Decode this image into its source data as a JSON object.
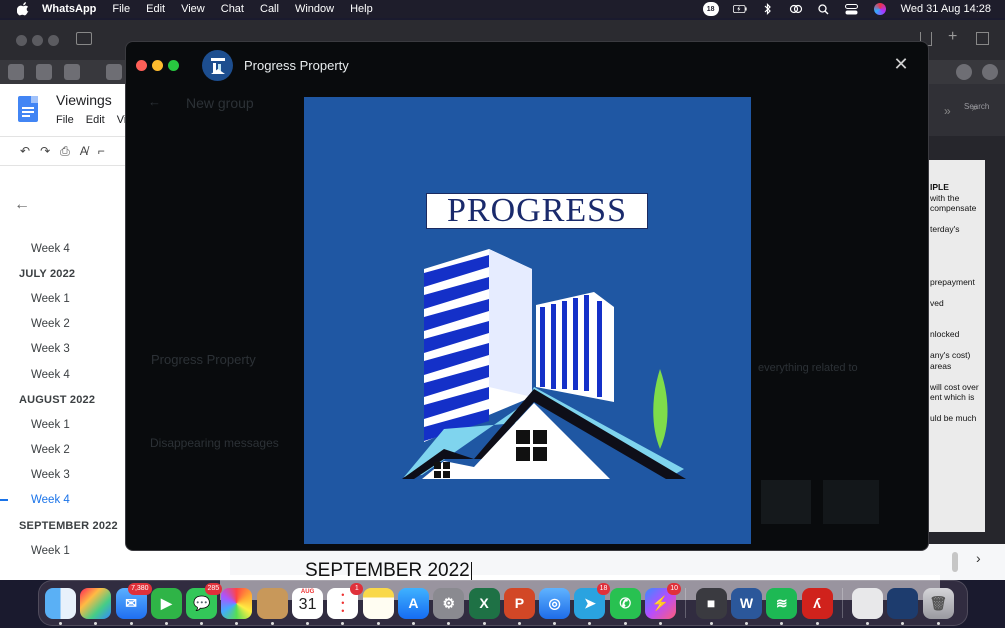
{
  "menubar": {
    "app_name": "WhatsApp",
    "items": [
      "File",
      "Edit",
      "View",
      "Chat",
      "Call",
      "Window",
      "Help"
    ],
    "status_badge": "18",
    "clock": "Wed 31 Aug  14:28"
  },
  "docs": {
    "title": "Viewings",
    "menu": [
      "File",
      "Edit",
      "Vi"
    ],
    "outline": [
      {
        "label": "Week 4",
        "kind": "week"
      },
      {
        "label": "JULY 2022",
        "kind": "heading"
      },
      {
        "label": "Week 1",
        "kind": "week"
      },
      {
        "label": "Week 2",
        "kind": "week"
      },
      {
        "label": "Week 3",
        "kind": "week"
      },
      {
        "label": "Week 4",
        "kind": "week"
      },
      {
        "label": "AUGUST 2022",
        "kind": "heading"
      },
      {
        "label": "Week 1",
        "kind": "week"
      },
      {
        "label": "Week 2",
        "kind": "week"
      },
      {
        "label": "Week 3",
        "kind": "week"
      },
      {
        "label": "Week 4",
        "kind": "week",
        "active": true
      },
      {
        "label": "SEPTEMBER 2022",
        "kind": "heading"
      },
      {
        "label": "Week 1",
        "kind": "week"
      }
    ],
    "body_text": "SEPTEMBER 2022"
  },
  "whatsapp_backdrop": {
    "header": "New group",
    "name_field": "Progress Property",
    "disappearing": "Disappearing messages",
    "description_snippet": "everything related to"
  },
  "right_doc": {
    "search_label": "Search",
    "lines": [
      "IPLE",
      "with the",
      "compensate",
      "",
      "terday's",
      "",
      "",
      "",
      "",
      "prepayment",
      "",
      "ved",
      "",
      "",
      "nlocked",
      "",
      "any's cost)",
      "areas",
      "",
      "will cost over",
      "ent which is",
      "",
      "uld be much"
    ]
  },
  "media_viewer": {
    "title": "Progress Property",
    "logo_text": "PROGRESS",
    "colors": {
      "background": "#1f57a3",
      "building_blue": "#1430c8",
      "roof": "#7fd4ee",
      "tree": "#7fdc4a"
    }
  },
  "dock": {
    "apps": [
      {
        "name": "finder",
        "badge": ""
      },
      {
        "name": "launchpad",
        "badge": ""
      },
      {
        "name": "mail",
        "badge": "7,380"
      },
      {
        "name": "facetime",
        "badge": ""
      },
      {
        "name": "messages",
        "badge": "285"
      },
      {
        "name": "photos",
        "badge": ""
      },
      {
        "name": "contacts",
        "badge": ""
      },
      {
        "name": "calendar",
        "badge": "",
        "month": "AUG",
        "day": "31"
      },
      {
        "name": "reminders",
        "badge": "1"
      },
      {
        "name": "notes",
        "badge": ""
      },
      {
        "name": "app-store",
        "badge": ""
      },
      {
        "name": "system-preferences",
        "badge": ""
      },
      {
        "name": "excel",
        "badge": ""
      },
      {
        "name": "powerpoint",
        "badge": ""
      },
      {
        "name": "safari",
        "badge": ""
      },
      {
        "name": "telegram",
        "badge": "18"
      },
      {
        "name": "whatsapp",
        "badge": ""
      },
      {
        "name": "messenger",
        "badge": "10"
      },
      {
        "name": "zoom",
        "badge": ""
      },
      {
        "name": "word",
        "badge": ""
      },
      {
        "name": "spotify",
        "badge": ""
      },
      {
        "name": "acrobat",
        "badge": ""
      },
      {
        "name": "document-stack",
        "badge": ""
      },
      {
        "name": "downloads-stack",
        "badge": ""
      },
      {
        "name": "trash",
        "badge": ""
      }
    ]
  }
}
